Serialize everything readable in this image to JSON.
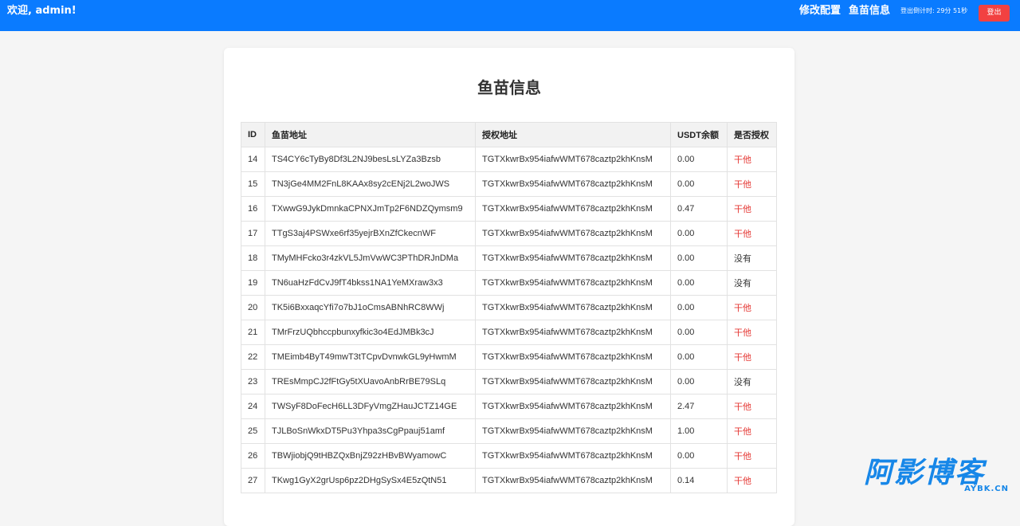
{
  "header": {
    "welcome": "欢迎, admin!",
    "nav": [
      {
        "label": "修改配置"
      },
      {
        "label": "鱼苗信息"
      }
    ],
    "countdown": "登出倒计时: 29分 51秒",
    "logout_label": "登出"
  },
  "main": {
    "title": "鱼苗信息",
    "columns": [
      "ID",
      "鱼苗地址",
      "授权地址",
      "USDT余额",
      "是否授权"
    ],
    "rows": [
      {
        "id": "14",
        "fish_address": "TS4CY6cTyBy8Df3L2NJ9besLsLYZa3Bzsb",
        "auth_address": "TGTXkwrBx954iafwWMT678caztp2khKnsM",
        "balance": "0.00",
        "authorized": "干他"
      },
      {
        "id": "15",
        "fish_address": "TN3jGe4MM2FnL8KAAx8sy2cENj2L2woJWS",
        "auth_address": "TGTXkwrBx954iafwWMT678caztp2khKnsM",
        "balance": "0.00",
        "authorized": "干他"
      },
      {
        "id": "16",
        "fish_address": "TXwwG9JykDmnkaCPNXJmTp2F6NDZQymsm9",
        "auth_address": "TGTXkwrBx954iafwWMT678caztp2khKnsM",
        "balance": "0.47",
        "authorized": "干他"
      },
      {
        "id": "17",
        "fish_address": "TTgS3aj4PSWxe6rf35yejrBXnZfCkecnWF",
        "auth_address": "TGTXkwrBx954iafwWMT678caztp2khKnsM",
        "balance": "0.00",
        "authorized": "干他"
      },
      {
        "id": "18",
        "fish_address": "TMyMHFcko3r4zkVL5JmVwWC3PThDRJnDMa",
        "auth_address": "TGTXkwrBx954iafwWMT678caztp2khKnsM",
        "balance": "0.00",
        "authorized": "没有"
      },
      {
        "id": "19",
        "fish_address": "TN6uaHzFdCvJ9fT4bkss1NA1YeMXraw3x3",
        "auth_address": "TGTXkwrBx954iafwWMT678caztp2khKnsM",
        "balance": "0.00",
        "authorized": "没有"
      },
      {
        "id": "20",
        "fish_address": "TK5i6BxxaqcYfi7o7bJ1oCmsABNhRC8WWj",
        "auth_address": "TGTXkwrBx954iafwWMT678caztp2khKnsM",
        "balance": "0.00",
        "authorized": "干他"
      },
      {
        "id": "21",
        "fish_address": "TMrFrzUQbhccpbunxyfkic3o4EdJMBk3cJ",
        "auth_address": "TGTXkwrBx954iafwWMT678caztp2khKnsM",
        "balance": "0.00",
        "authorized": "干他"
      },
      {
        "id": "22",
        "fish_address": "TMEimb4ByT49mwT3tTCpvDvnwkGL9yHwmM",
        "auth_address": "TGTXkwrBx954iafwWMT678caztp2khKnsM",
        "balance": "0.00",
        "authorized": "干他"
      },
      {
        "id": "23",
        "fish_address": "TREsMmpCJ2fFtGy5tXUavoAnbRrBE79SLq",
        "auth_address": "TGTXkwrBx954iafwWMT678caztp2khKnsM",
        "balance": "0.00",
        "authorized": "没有"
      },
      {
        "id": "24",
        "fish_address": "TWSyF8DoFecH6LL3DFyVmgZHauJCTZ14GE",
        "auth_address": "TGTXkwrBx954iafwWMT678caztp2khKnsM",
        "balance": "2.47",
        "authorized": "干他"
      },
      {
        "id": "25",
        "fish_address": "TJLBoSnWkxDT5Pu3Yhpa3sCgPpauj51amf",
        "auth_address": "TGTXkwrBx954iafwWMT678caztp2khKnsM",
        "balance": "1.00",
        "authorized": "干他"
      },
      {
        "id": "26",
        "fish_address": "TBWjiobjQ9tHBZQxBnjZ92zHBvBWyamowC",
        "auth_address": "TGTXkwrBx954iafwWMT678caztp2khKnsM",
        "balance": "0.00",
        "authorized": "干他"
      },
      {
        "id": "27",
        "fish_address": "TKwg1GyX2grUsp6pz2DHgSySx4E5zQtN51",
        "auth_address": "TGTXkwrBx954iafwWMT678caztp2khKnsM",
        "balance": "0.14",
        "authorized": "干他"
      }
    ]
  },
  "watermark": {
    "text": "阿影博客",
    "domain": "AYBK.CN"
  },
  "colors": {
    "header_bg": "#0a7bff",
    "logout_bg": "#f24141",
    "authorized_text": "#e53935",
    "watermark": "#1787e8"
  }
}
